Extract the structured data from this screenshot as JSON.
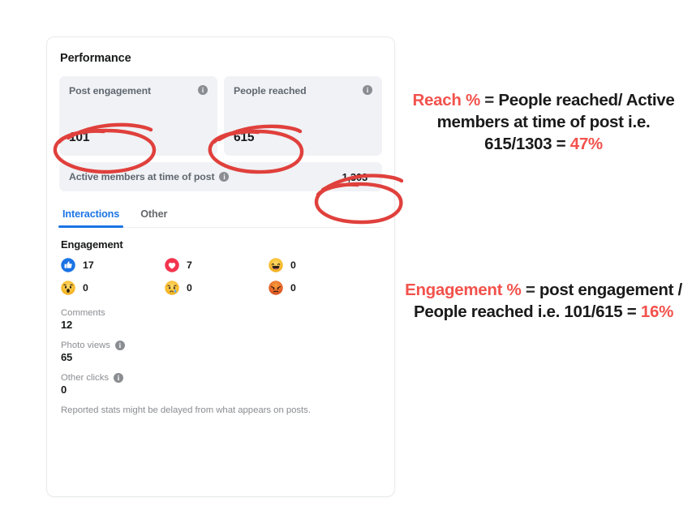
{
  "card": {
    "title": "Performance",
    "footnote": "Reported stats might be delayed from what appears on posts.",
    "info_icon": "info-icon",
    "info_glyph": "i"
  },
  "stats": {
    "tiles": [
      {
        "label": "Post engagement",
        "value": "101",
        "has_info": true
      },
      {
        "label": "People reached",
        "value": "615",
        "has_info": true
      }
    ],
    "wide_tile": {
      "label": "Active members at time of post",
      "value": "1,303",
      "has_info": true
    }
  },
  "tabs": [
    {
      "label": "Interactions",
      "active": true
    },
    {
      "label": "Other",
      "active": false
    }
  ],
  "engagement": {
    "heading": "Engagement",
    "reactions": [
      {
        "name": "like-reaction-icon",
        "label": "Like",
        "count": "17"
      },
      {
        "name": "love-reaction-icon",
        "label": "Love",
        "count": "7"
      },
      {
        "name": "haha-reaction-icon",
        "label": "Haha",
        "count": "0"
      },
      {
        "name": "wow-reaction-icon",
        "label": "Wow",
        "count": "0"
      },
      {
        "name": "sad-reaction-icon",
        "label": "Sad",
        "count": "0"
      },
      {
        "name": "angry-reaction-icon",
        "label": "Angry",
        "count": "0"
      }
    ]
  },
  "metrics": [
    {
      "label": "Comments",
      "value": "12",
      "has_info": false
    },
    {
      "label": "Photo views",
      "value": "65",
      "has_info": true
    },
    {
      "label": "Other clicks",
      "value": "0",
      "has_info": true
    }
  ],
  "notes": {
    "reach": {
      "term": "Reach %",
      "equals": "=",
      "body": "People reached/ Active members at time of  post i.e. 615/1303 =",
      "result": "47%"
    },
    "engagement": {
      "term": "Engagement %",
      "equals": "=",
      "body": "post engagement / People reached i.e. 101/615 =",
      "result": "16%"
    }
  },
  "colors": {
    "accent_red": "#f2524c",
    "annotation_red": "#e0403c",
    "link_blue": "#1b74e4",
    "tile_gray": "#f0f2f5",
    "text_primary": "#18191a",
    "text_secondary": "#606770",
    "text_muted": "#8a8d91"
  },
  "annotations": {
    "circled": [
      "101",
      "615",
      "1,303"
    ]
  }
}
